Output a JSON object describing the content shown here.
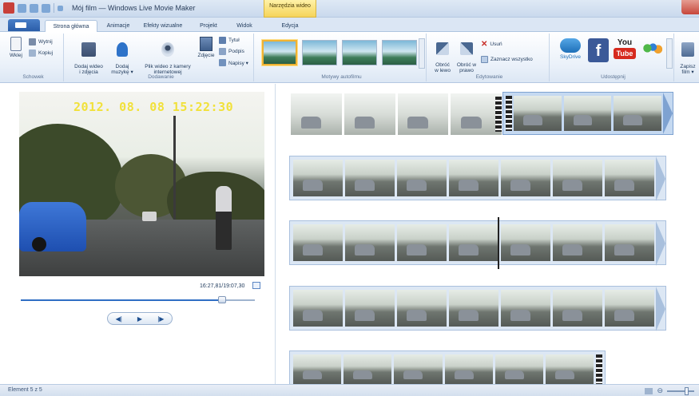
{
  "window": {
    "title": "Mój film — Windows Live Movie Maker",
    "context_tab": "Narzędzia wideo"
  },
  "tabs": [
    {
      "label": "Strona główna",
      "active": true
    },
    {
      "label": "Animacje",
      "active": false
    },
    {
      "label": "Efekty wizualne",
      "active": false
    },
    {
      "label": "Projekt",
      "active": false
    },
    {
      "label": "Widok",
      "active": false
    },
    {
      "label": "Edycja",
      "active": false
    }
  ],
  "ribbon": {
    "clipboard": {
      "label": "Schowek",
      "paste": "Wklej",
      "cut": "Wytnij",
      "copy": "Kopiuj"
    },
    "add": {
      "label": "Dodawanie",
      "add_video": "Dodaj wideo\ni zdjęcia",
      "add_music": "Dodaj\nmuzykę ▾",
      "webcam": "Plik wideo z kamery\ninternetowej",
      "snapshot": "Zdjęcie",
      "title": "Tytuł",
      "caption": "Podpis",
      "credits": "Napisy ▾"
    },
    "themes": {
      "label": "Motywy autofilmu",
      "count": 4
    },
    "editing": {
      "label": "Edytowanie",
      "rotate_left": "Obróć\nw lewo",
      "rotate_right": "Obróć w\nprawo",
      "remove": "Usuń",
      "select_all": "Zaznacz wszystko"
    },
    "share": {
      "label": "Udostępnij",
      "skydrive": "SkyDrive",
      "youtube_top": "You",
      "youtube_bottom": "Tube",
      "save_movie": "Zapisz\nfilm ▾"
    }
  },
  "preview": {
    "timestamp": "2012. 08. 08 15:22:30",
    "time_readout": "16:27,81/19:07,30",
    "progress": 0.86
  },
  "storyboard": {
    "selected_row": 0
  },
  "status": {
    "element_text": "Element 5 z 5"
  },
  "colors": {
    "accent": "#2f6ec4",
    "ribbon_bg": "#e9f0f9",
    "selected_theme": "#f0b232",
    "youtube_red": "#d62a1e",
    "facebook_blue": "#3b5998"
  }
}
